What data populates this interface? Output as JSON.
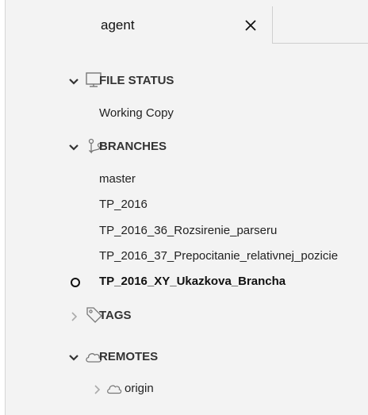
{
  "tab": {
    "title": "agent"
  },
  "file_status": {
    "label": "FILE STATUS",
    "items": [
      "Working Copy"
    ]
  },
  "branches": {
    "label": "BRANCHES",
    "items": [
      "master",
      "TP_2016",
      "TP_2016_36_Rozsirenie_parseru",
      "TP_2016_37_Prepocitanie_relativnej_pozicie",
      "TP_2016_XY_Ukazkova_Brancha"
    ],
    "current": "TP_2016_XY_Ukazkova_Brancha"
  },
  "tags": {
    "label": "TAGS"
  },
  "remotes": {
    "label": "REMOTES",
    "items": [
      "origin"
    ]
  }
}
